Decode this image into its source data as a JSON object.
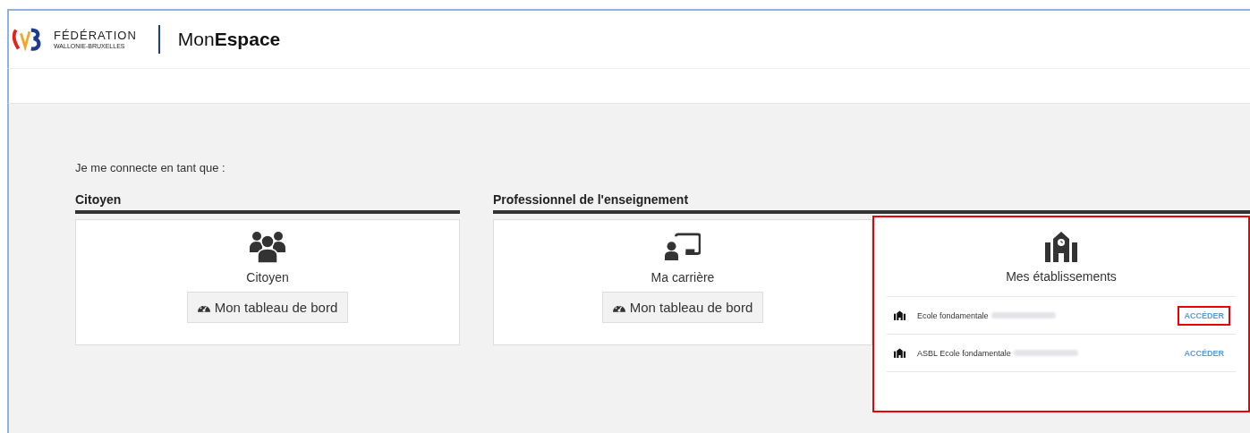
{
  "header": {
    "logo_line1": "FÉDÉRATION",
    "logo_line2": "WALLONIE-BRUXELLES",
    "app_title_light": "Mon",
    "app_title_bold": "Espace"
  },
  "intro": "Je me connecte en tant que :",
  "sections": [
    {
      "title": "Citoyen",
      "cards": [
        {
          "kind": "people",
          "label": "Citoyen",
          "button": "Mon tableau de bord"
        }
      ]
    },
    {
      "title": "Professionnel de l'enseignement",
      "cards": [
        {
          "kind": "teacher",
          "label": "Ma carrière",
          "button": "Mon tableau de bord"
        },
        {
          "kind": "schools",
          "label": "Mes établissements",
          "highlighted": true,
          "schools": [
            {
              "name": "Ecole fondamentale",
              "link": "ACCÉDER",
              "highlighted": true
            },
            {
              "name": "ASBL Ecole fondamentale",
              "link": "ACCÉDER",
              "highlighted": false
            }
          ]
        }
      ]
    }
  ]
}
